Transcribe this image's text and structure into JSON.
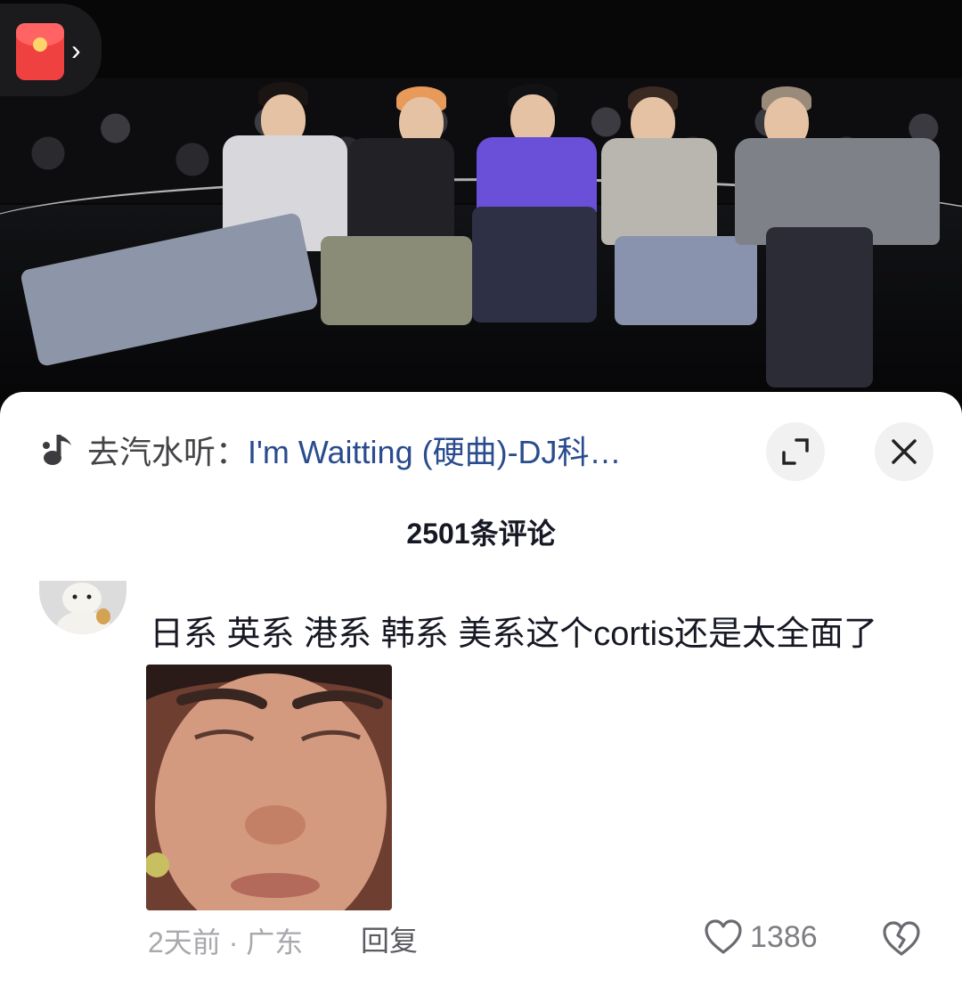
{
  "video": {
    "redpacket_icon": "red-envelope-icon",
    "chevron_icon": "chevron-right-icon"
  },
  "music": {
    "icon": "music-note-icon",
    "prefix": "去汽水听：",
    "title": "I'm Waitting (硬曲)-DJ科…"
  },
  "controls": {
    "expand_icon": "expand-icon",
    "close_icon": "close-icon"
  },
  "comments": {
    "count_label": "2501条评论",
    "items": [
      {
        "text": "日系 英系 港系 韩系 美系这个cortis还是太全面了",
        "time_location": "2天前 · 广东",
        "reply_label": "回复",
        "like_count": "1386"
      }
    ]
  },
  "colors": {
    "title_link": "#2a4c8e",
    "text_primary": "#161823",
    "text_secondary": "#a8a8ad"
  }
}
